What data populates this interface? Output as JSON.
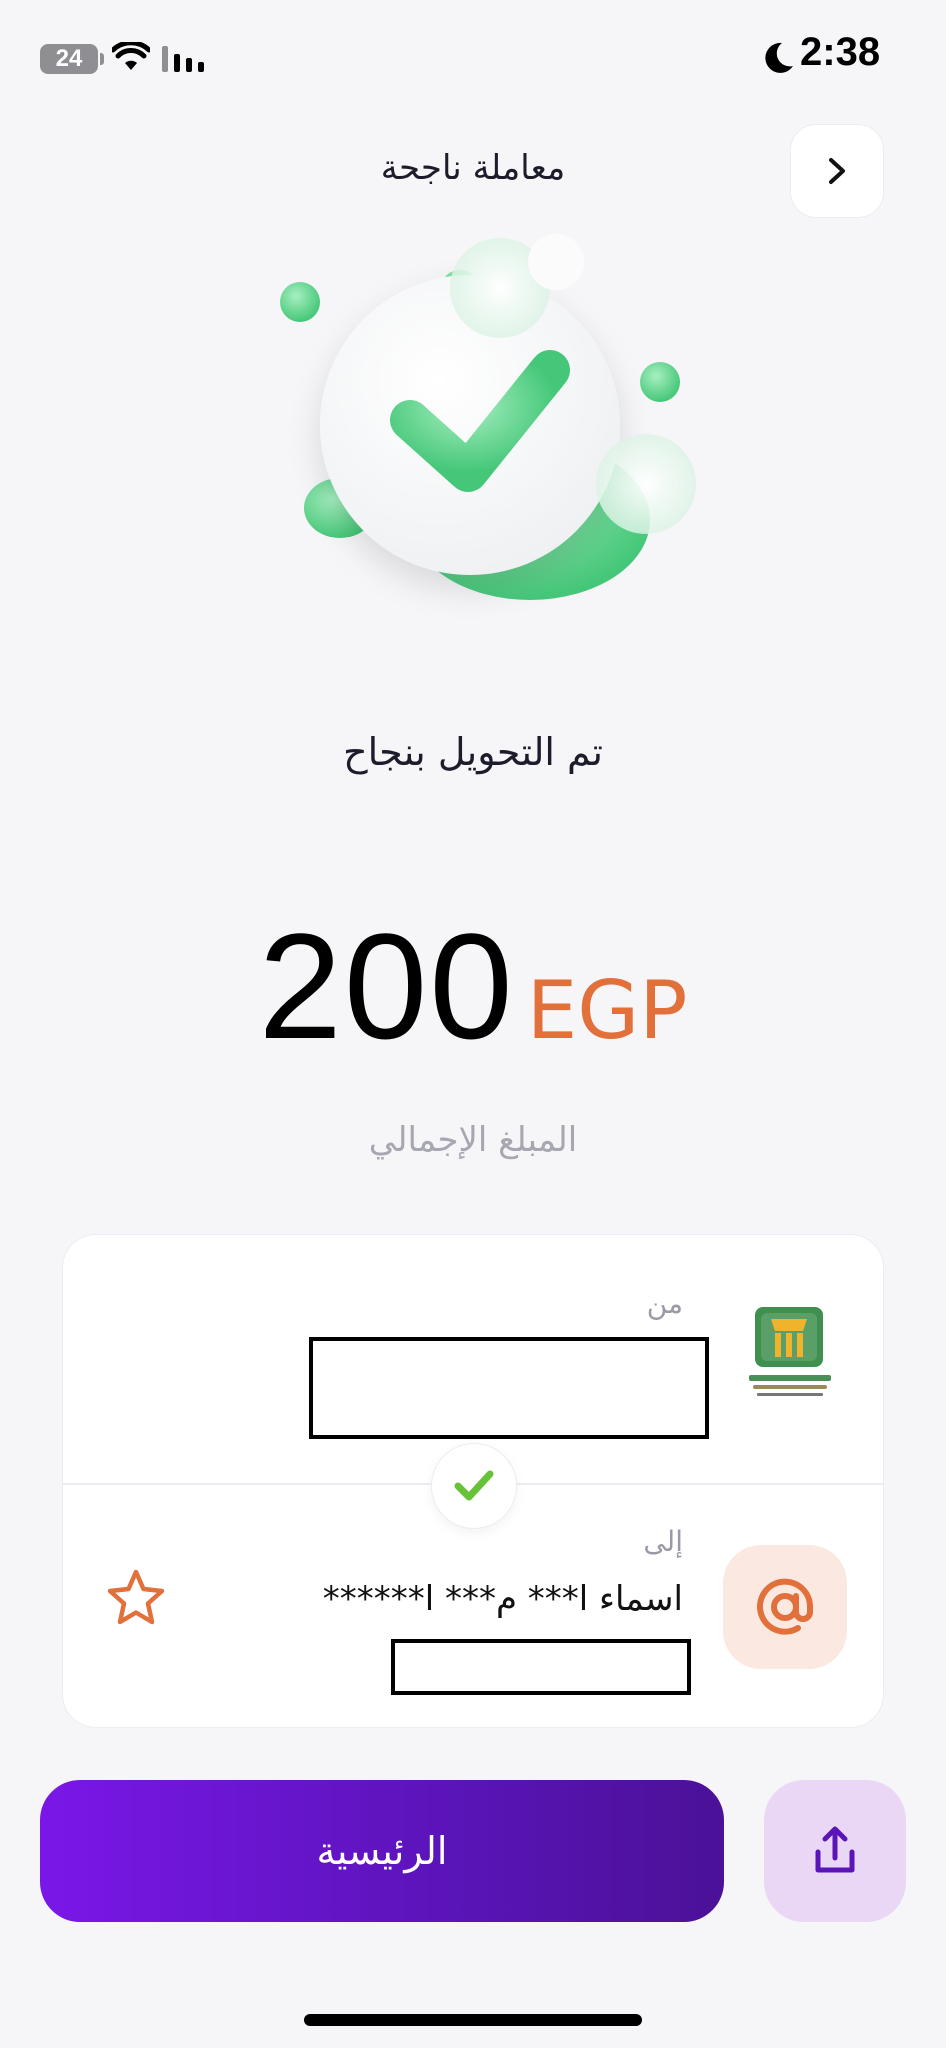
{
  "status_bar": {
    "battery": "24",
    "time": "2:38",
    "icons": [
      "battery-icon",
      "wifi-icon",
      "signal-icon",
      "moon-icon"
    ]
  },
  "header": {
    "title": "معاملة ناجحة",
    "nav_icon": "chevron-right-icon"
  },
  "hero": {
    "icon": "success-check-illustration",
    "accent_color": "#5fd68a"
  },
  "result": {
    "message": "تم التحويل بنجاح",
    "amount": "200",
    "currency": "EGP",
    "amount_label": "المبلغ الإجمالي",
    "currency_color": "#e2703a"
  },
  "details": {
    "from_label": "من",
    "from_icon": "bank-logo-icon",
    "to_label": "إلى",
    "recipient_name": "اسماء ا*** م*** ا******",
    "to_icon": "at-sign-icon",
    "favorite_icon": "star-outline-icon",
    "divider_icon": "checkmark-icon"
  },
  "actions": {
    "home_label": "الرئيسية",
    "share_icon": "share-icon",
    "primary_color": "#6a16d4"
  }
}
